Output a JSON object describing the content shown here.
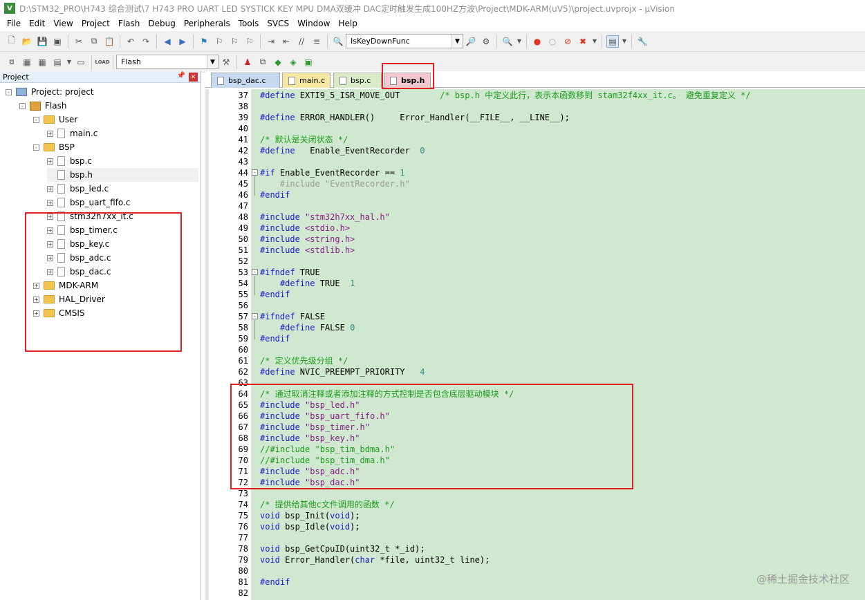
{
  "window": {
    "title": "D:\\STM32_PRO\\H743 综合测试\\7 H743 PRO UART LED SYSTICK KEY MPU DMA双缓冲 DAC定时触发生成100HZ方波\\Project\\MDK-ARM(uV5)\\project.uvprojx - µVision",
    "app_icon": "keil-uvision-icon"
  },
  "menu": [
    "File",
    "Edit",
    "View",
    "Project",
    "Flash",
    "Debug",
    "Peripherals",
    "Tools",
    "SVCS",
    "Window",
    "Help"
  ],
  "toolbar": {
    "find_combo": "IsKeyDownFunc",
    "target_combo": "Flash"
  },
  "project_panel": {
    "title": "Project",
    "tree": [
      {
        "label": "Project: project",
        "depth": 0,
        "kind": "project",
        "exp": "-"
      },
      {
        "label": "Flash",
        "depth": 1,
        "kind": "target",
        "exp": "-"
      },
      {
        "label": "User",
        "depth": 2,
        "kind": "folder",
        "exp": "-"
      },
      {
        "label": "main.c",
        "depth": 3,
        "kind": "file",
        "exp": "+"
      },
      {
        "label": "BSP",
        "depth": 2,
        "kind": "folder",
        "exp": "-"
      },
      {
        "label": "bsp.c",
        "depth": 3,
        "kind": "file",
        "exp": "+"
      },
      {
        "label": "bsp.h",
        "depth": 3,
        "kind": "file",
        "exp": "",
        "selected": true
      },
      {
        "label": "bsp_led.c",
        "depth": 3,
        "kind": "file",
        "exp": "+"
      },
      {
        "label": "bsp_uart_fifo.c",
        "depth": 3,
        "kind": "file",
        "exp": "+"
      },
      {
        "label": "stm32h7xx_it.c",
        "depth": 3,
        "kind": "file",
        "exp": "+"
      },
      {
        "label": "bsp_timer.c",
        "depth": 3,
        "kind": "file",
        "exp": "+"
      },
      {
        "label": "bsp_key.c",
        "depth": 3,
        "kind": "file",
        "exp": "+"
      },
      {
        "label": "bsp_adc.c",
        "depth": 3,
        "kind": "file",
        "exp": "+"
      },
      {
        "label": "bsp_dac.c",
        "depth": 3,
        "kind": "file",
        "exp": "+"
      },
      {
        "label": "MDK-ARM",
        "depth": 2,
        "kind": "folder",
        "exp": "+"
      },
      {
        "label": "HAL_Driver",
        "depth": 2,
        "kind": "folder",
        "exp": "+"
      },
      {
        "label": "CMSIS",
        "depth": 2,
        "kind": "folder",
        "exp": "+"
      }
    ]
  },
  "editor": {
    "tabs": [
      {
        "label": "bsp_dac.c",
        "color": "#c7d9f1",
        "active": false
      },
      {
        "label": "main.c",
        "color": "#f6e7a2",
        "active": false
      },
      {
        "label": "bsp.c",
        "color": "#d9ecc7",
        "active": false
      },
      {
        "label": "bsp.h",
        "color": "#f5c8cf",
        "active": true
      }
    ],
    "lines": [
      {
        "n": 37,
        "t": [
          [
            "pp",
            "#define "
          ],
          [
            "",
            "EXTI9_5_ISR_MOVE_OUT        "
          ],
          [
            "c",
            "/* bsp.h 中定义此行，表示本函数移到 stam32f4xx_it.c。 避免重复定义 */"
          ]
        ]
      },
      {
        "n": 38,
        "t": []
      },
      {
        "n": 39,
        "t": [
          [
            "pp",
            "#define "
          ],
          [
            "",
            "ERROR_HANDLER()     Error_Handler(__FILE__, __LINE__);"
          ]
        ]
      },
      {
        "n": 40,
        "t": []
      },
      {
        "n": 41,
        "t": [
          [
            "c",
            "/* 默认是关闭状态 */"
          ]
        ]
      },
      {
        "n": 42,
        "t": [
          [
            "pp",
            "#define "
          ],
          [
            "",
            "  Enable_EventRecorder  "
          ],
          [
            "n",
            "0"
          ]
        ]
      },
      {
        "n": 43,
        "t": []
      },
      {
        "n": 44,
        "t": [
          [
            "pp",
            "#if "
          ],
          [
            "",
            "Enable_EventRecorder == "
          ],
          [
            "n",
            "1"
          ]
        ],
        "fold": "-"
      },
      {
        "n": 45,
        "t": [
          [
            "g",
            "    #include \"EventRecorder.h\""
          ]
        ]
      },
      {
        "n": 46,
        "t": [
          [
            "pp",
            "#endif"
          ]
        ]
      },
      {
        "n": 47,
        "t": []
      },
      {
        "n": 48,
        "t": [
          [
            "pp",
            "#include "
          ],
          [
            "s",
            "\"stm32h7xx_hal.h\""
          ]
        ]
      },
      {
        "n": 49,
        "t": [
          [
            "pp",
            "#include "
          ],
          [
            "s",
            "<stdio.h>"
          ]
        ]
      },
      {
        "n": 50,
        "t": [
          [
            "pp",
            "#include "
          ],
          [
            "s",
            "<string.h>"
          ]
        ]
      },
      {
        "n": 51,
        "t": [
          [
            "pp",
            "#include "
          ],
          [
            "s",
            "<stdlib.h>"
          ]
        ]
      },
      {
        "n": 52,
        "t": []
      },
      {
        "n": 53,
        "t": [
          [
            "pp",
            "#ifndef "
          ],
          [
            "",
            "TRUE"
          ]
        ],
        "fold": "-"
      },
      {
        "n": 54,
        "t": [
          [
            "pp",
            "    #define "
          ],
          [
            "",
            "TRUE  "
          ],
          [
            "n",
            "1"
          ]
        ]
      },
      {
        "n": 55,
        "t": [
          [
            "pp",
            "#endif"
          ]
        ]
      },
      {
        "n": 56,
        "t": []
      },
      {
        "n": 57,
        "t": [
          [
            "pp",
            "#ifndef "
          ],
          [
            "",
            "FALSE"
          ]
        ],
        "fold": "-"
      },
      {
        "n": 58,
        "t": [
          [
            "pp",
            "    #define "
          ],
          [
            "",
            "FALSE "
          ],
          [
            "n",
            "0"
          ]
        ]
      },
      {
        "n": 59,
        "t": [
          [
            "pp",
            "#endif"
          ]
        ]
      },
      {
        "n": 60,
        "t": []
      },
      {
        "n": 61,
        "t": [
          [
            "c",
            "/* 定义优先级分组 */"
          ]
        ]
      },
      {
        "n": 62,
        "t": [
          [
            "pp",
            "#define "
          ],
          [
            "",
            "NVIC_PREEMPT_PRIORITY   "
          ],
          [
            "n",
            "4"
          ]
        ]
      },
      {
        "n": 63,
        "t": []
      },
      {
        "n": 64,
        "t": [
          [
            "c",
            "/* 通过取消注释或者添加注释的方式控制是否包含底层驱动模块 */"
          ]
        ]
      },
      {
        "n": 65,
        "t": [
          [
            "pp",
            "#include "
          ],
          [
            "s",
            "\"bsp_led.h\""
          ]
        ]
      },
      {
        "n": 66,
        "t": [
          [
            "pp",
            "#include "
          ],
          [
            "s",
            "\"bsp_uart_fifo.h\""
          ]
        ]
      },
      {
        "n": 67,
        "t": [
          [
            "pp",
            "#include "
          ],
          [
            "s",
            "\"bsp_timer.h\""
          ]
        ]
      },
      {
        "n": 68,
        "t": [
          [
            "pp",
            "#include "
          ],
          [
            "s",
            "\"bsp_key.h\""
          ]
        ]
      },
      {
        "n": 69,
        "t": [
          [
            "c",
            "//#include \"bsp_tim_bdma.h\""
          ]
        ]
      },
      {
        "n": 70,
        "t": [
          [
            "c",
            "//#include \"bsp_tim_dma.h\""
          ]
        ]
      },
      {
        "n": 71,
        "t": [
          [
            "pp",
            "#include "
          ],
          [
            "s",
            "\"bsp_adc.h\""
          ]
        ]
      },
      {
        "n": 72,
        "t": [
          [
            "pp",
            "#include "
          ],
          [
            "s",
            "\"bsp_dac.h\""
          ]
        ]
      },
      {
        "n": 73,
        "t": []
      },
      {
        "n": 74,
        "t": [
          [
            "c",
            "/* 提供给其他c文件调用的函数 */"
          ]
        ]
      },
      {
        "n": 75,
        "t": [
          [
            "k",
            "void "
          ],
          [
            "",
            "bsp_Init("
          ],
          [
            "k",
            "void"
          ],
          [
            "",
            ");"
          ]
        ]
      },
      {
        "n": 76,
        "t": [
          [
            "k",
            "void "
          ],
          [
            "",
            "bsp_Idle("
          ],
          [
            "k",
            "void"
          ],
          [
            "",
            ");"
          ]
        ]
      },
      {
        "n": 77,
        "t": []
      },
      {
        "n": 78,
        "t": [
          [
            "k",
            "void "
          ],
          [
            "",
            "bsp_GetCpuID(uint32_t *_id);"
          ]
        ]
      },
      {
        "n": 79,
        "t": [
          [
            "k",
            "void "
          ],
          [
            "",
            "Error_Handler("
          ],
          [
            "k",
            "char "
          ],
          [
            "",
            "*file, uint32_t line);"
          ]
        ]
      },
      {
        "n": 80,
        "t": []
      },
      {
        "n": 81,
        "t": [
          [
            "pp",
            "#endif"
          ]
        ]
      },
      {
        "n": 82,
        "t": []
      }
    ]
  },
  "watermark": "@稀土掘金技术社区"
}
